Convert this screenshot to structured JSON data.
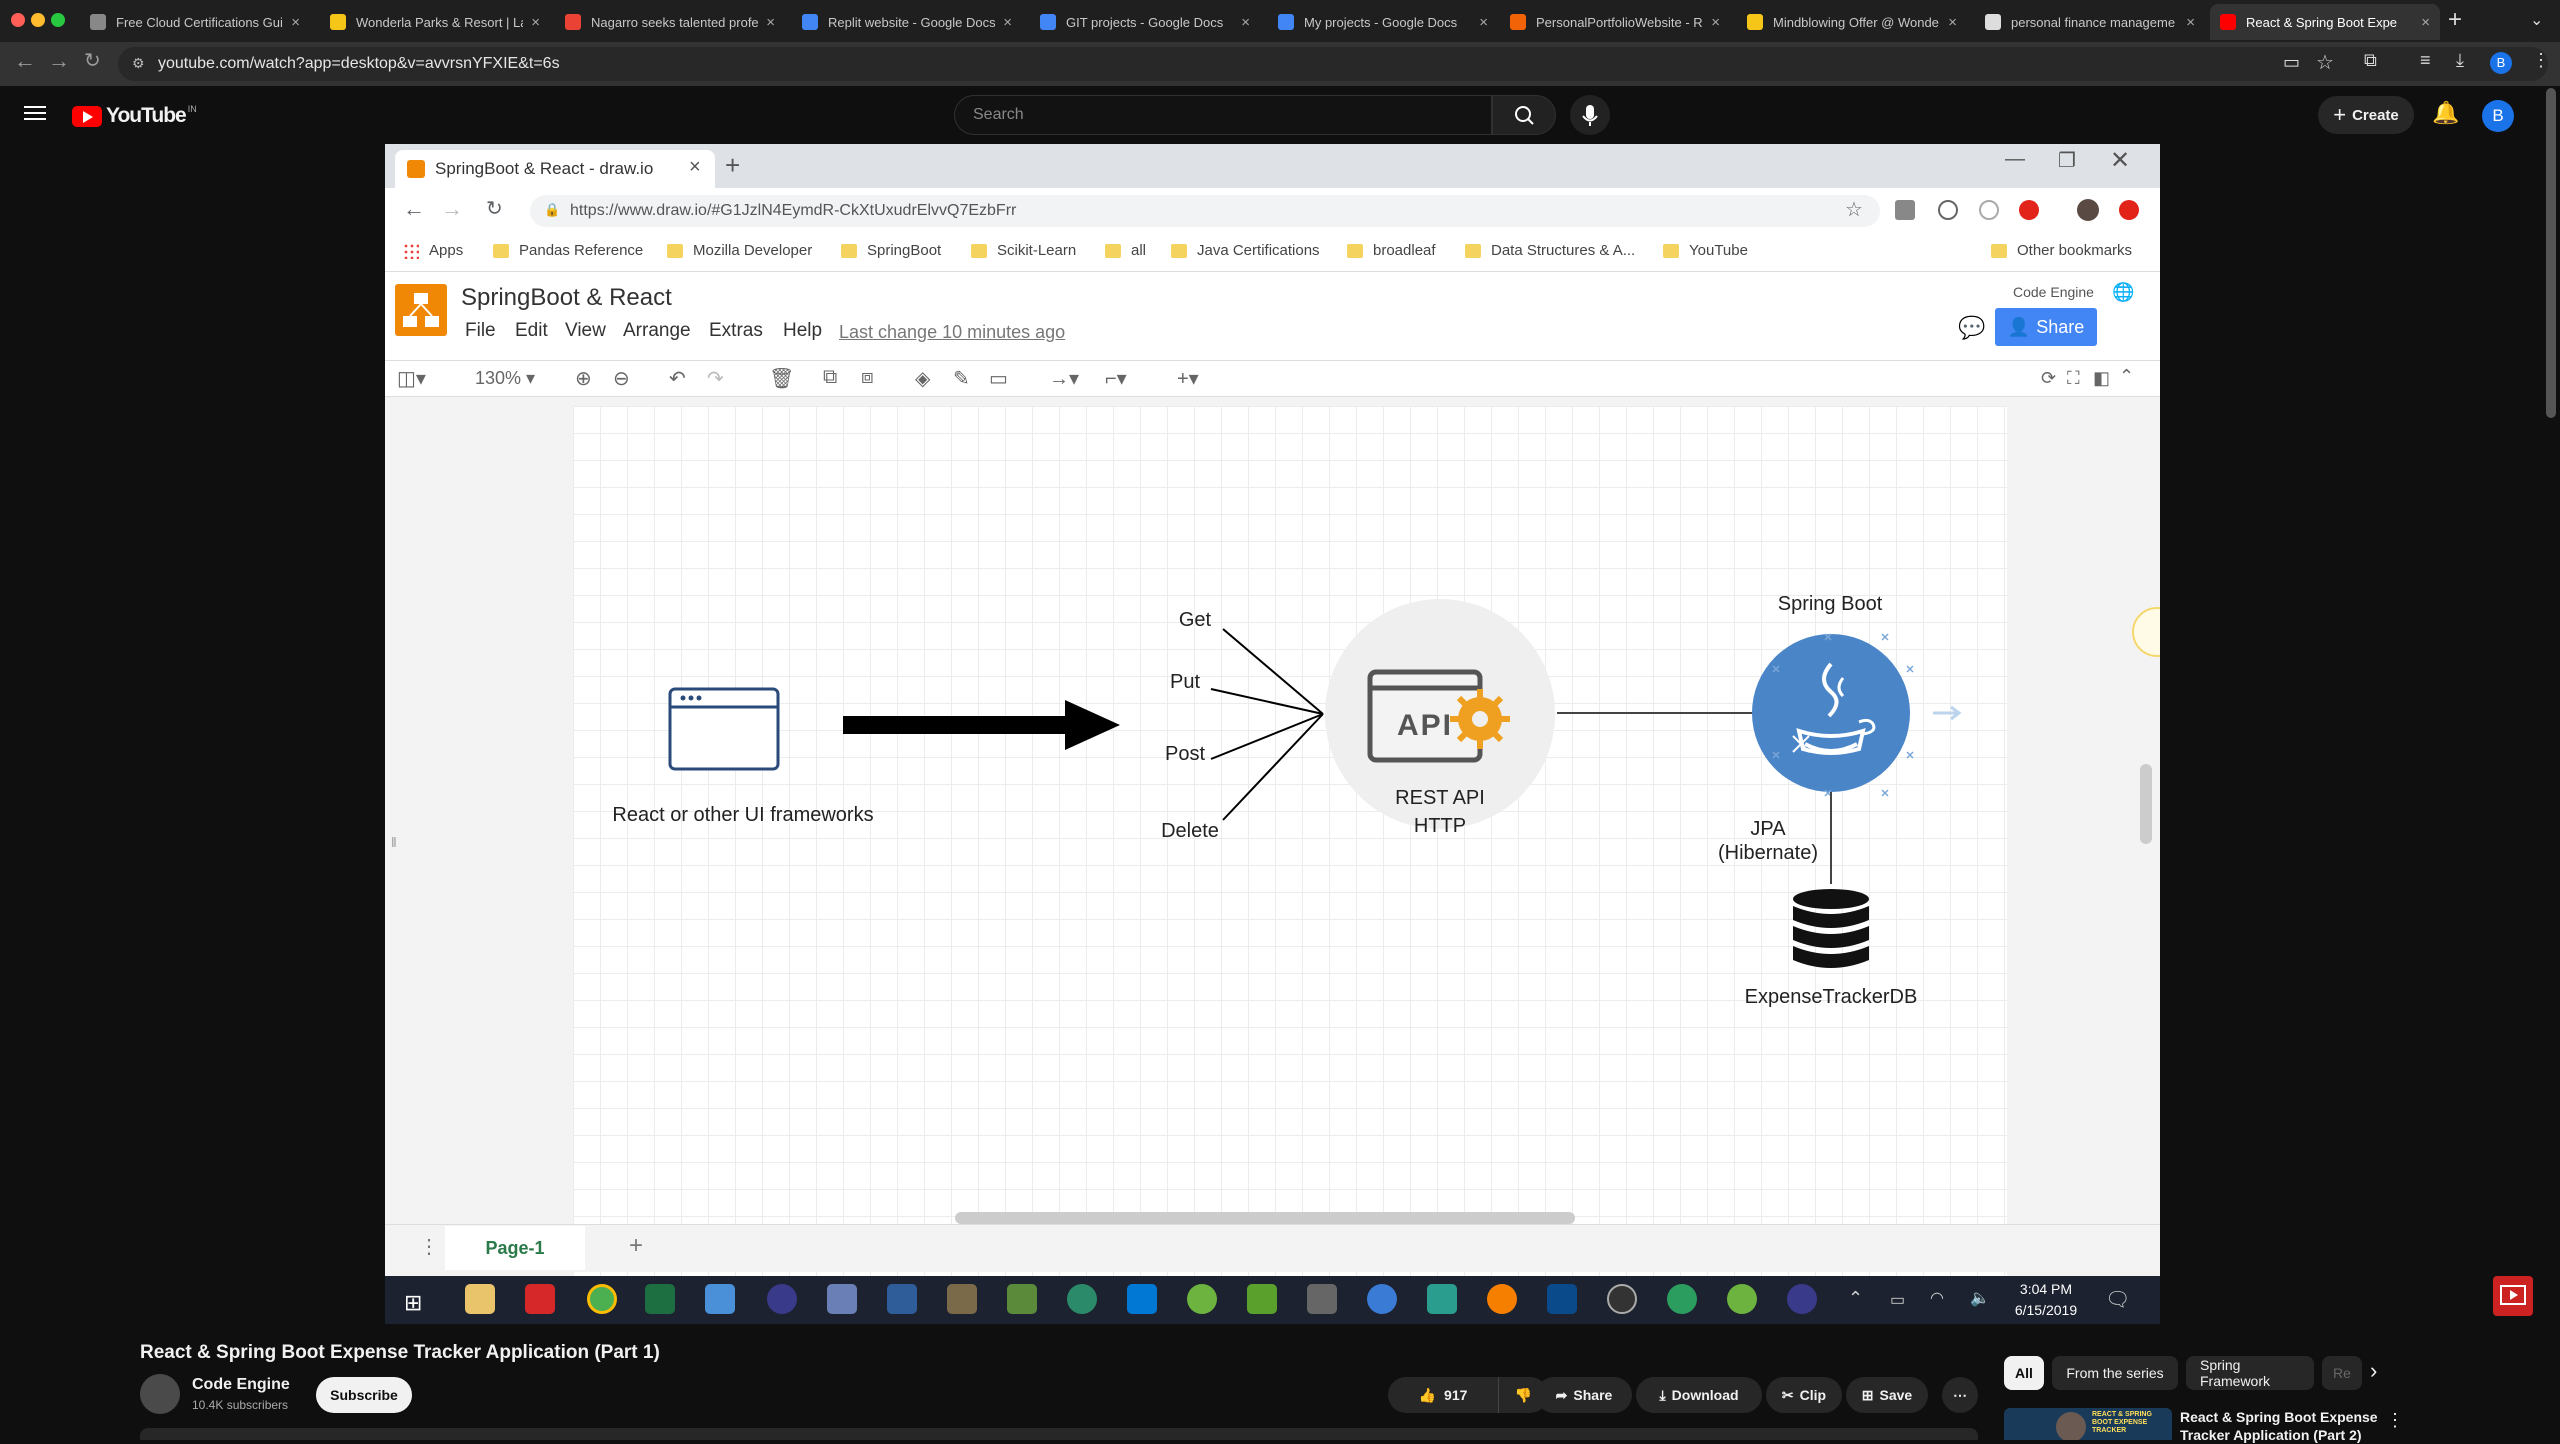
{
  "browser": {
    "tabs": [
      {
        "label": "Free Cloud Certifications Gui",
        "color": "#888888"
      },
      {
        "label": "Wonderla Parks & Resort | La",
        "color": "#f5c518"
      },
      {
        "label": "Nagarro seeks talented profe",
        "color": "#ea4335"
      },
      {
        "label": "Replit website - Google Docs",
        "color": "#4285f4"
      },
      {
        "label": "GIT projects - Google Docs",
        "color": "#4285f4"
      },
      {
        "label": "My projects - Google Docs",
        "color": "#4285f4"
      },
      {
        "label": "PersonalPortfolioWebsite - R",
        "color": "#f26207"
      },
      {
        "label": "Mindblowing Offer @ Wonde",
        "color": "#f5c518"
      },
      {
        "label": "personal finance manageme",
        "color": "#dddddd"
      },
      {
        "label": "React & Spring Boot Expe",
        "color": "#ff0000"
      }
    ],
    "close_glyph": "×",
    "new_tab": "+",
    "url": "youtube.com/watch?app=desktop&v=avvrsnYFXIE&t=6s"
  },
  "youtube": {
    "logo": "YouTube",
    "region": "IN",
    "search_placeholder": "Search",
    "create_label": "Create",
    "avatar_letter": "B",
    "video": {
      "title": "React & Spring Boot Expense Tracker Application (Part 1)",
      "channel": "Code Engine",
      "subscribers": "10.4K subscribers",
      "subscribe_label": "Subscribe",
      "likes": "917",
      "share_label": "Share",
      "download_label": "Download",
      "clip_label": "Clip",
      "save_label": "Save"
    },
    "chips": [
      "All",
      "From the series",
      "Spring Framework",
      "Re"
    ],
    "related": {
      "title_line1": "React & Spring Boot Expense",
      "title_line2": "Tracker Application (Part 2)",
      "thumb_text": "REACT & SPRING BOOT EXPENSE TRACKER"
    }
  },
  "inner_browser": {
    "tab_title": "SpringBoot & React - draw.io",
    "url": "https://www.draw.io/#G1JzlN4EymdR-CkXtUxudrElvvQ7EzbFrr",
    "bookmarks": [
      "Apps",
      "Pandas Reference",
      "Mozilla Developer",
      "SpringBoot",
      "Scikit-Learn",
      "all",
      "Java Certifications",
      "broadleaf",
      "Data Structures & A...",
      "YouTube",
      "Other bookmarks"
    ]
  },
  "drawio": {
    "title": "SpringBoot & React",
    "menus": [
      "File",
      "Edit",
      "View",
      "Arrange",
      "Extras",
      "Help"
    ],
    "last_change": "Last change 10 minutes ago",
    "account": "Code Engine",
    "share_label": "Share",
    "zoom": "130%",
    "page_tab": "Page-1",
    "diagram": {
      "ui_label": "React or other UI frameworks",
      "methods": [
        "Get",
        "Put",
        "Post",
        "Delete"
      ],
      "api_text": "API",
      "api_label_line1": "REST API",
      "api_label_line2": "HTTP",
      "spring_label": "Spring Boot",
      "jpa_line1": "JPA",
      "jpa_line2": "(Hibernate)",
      "db_label": "ExpenseTrackerDB"
    }
  },
  "taskbar": {
    "time": "3:04 PM",
    "date": "6/15/2019"
  }
}
